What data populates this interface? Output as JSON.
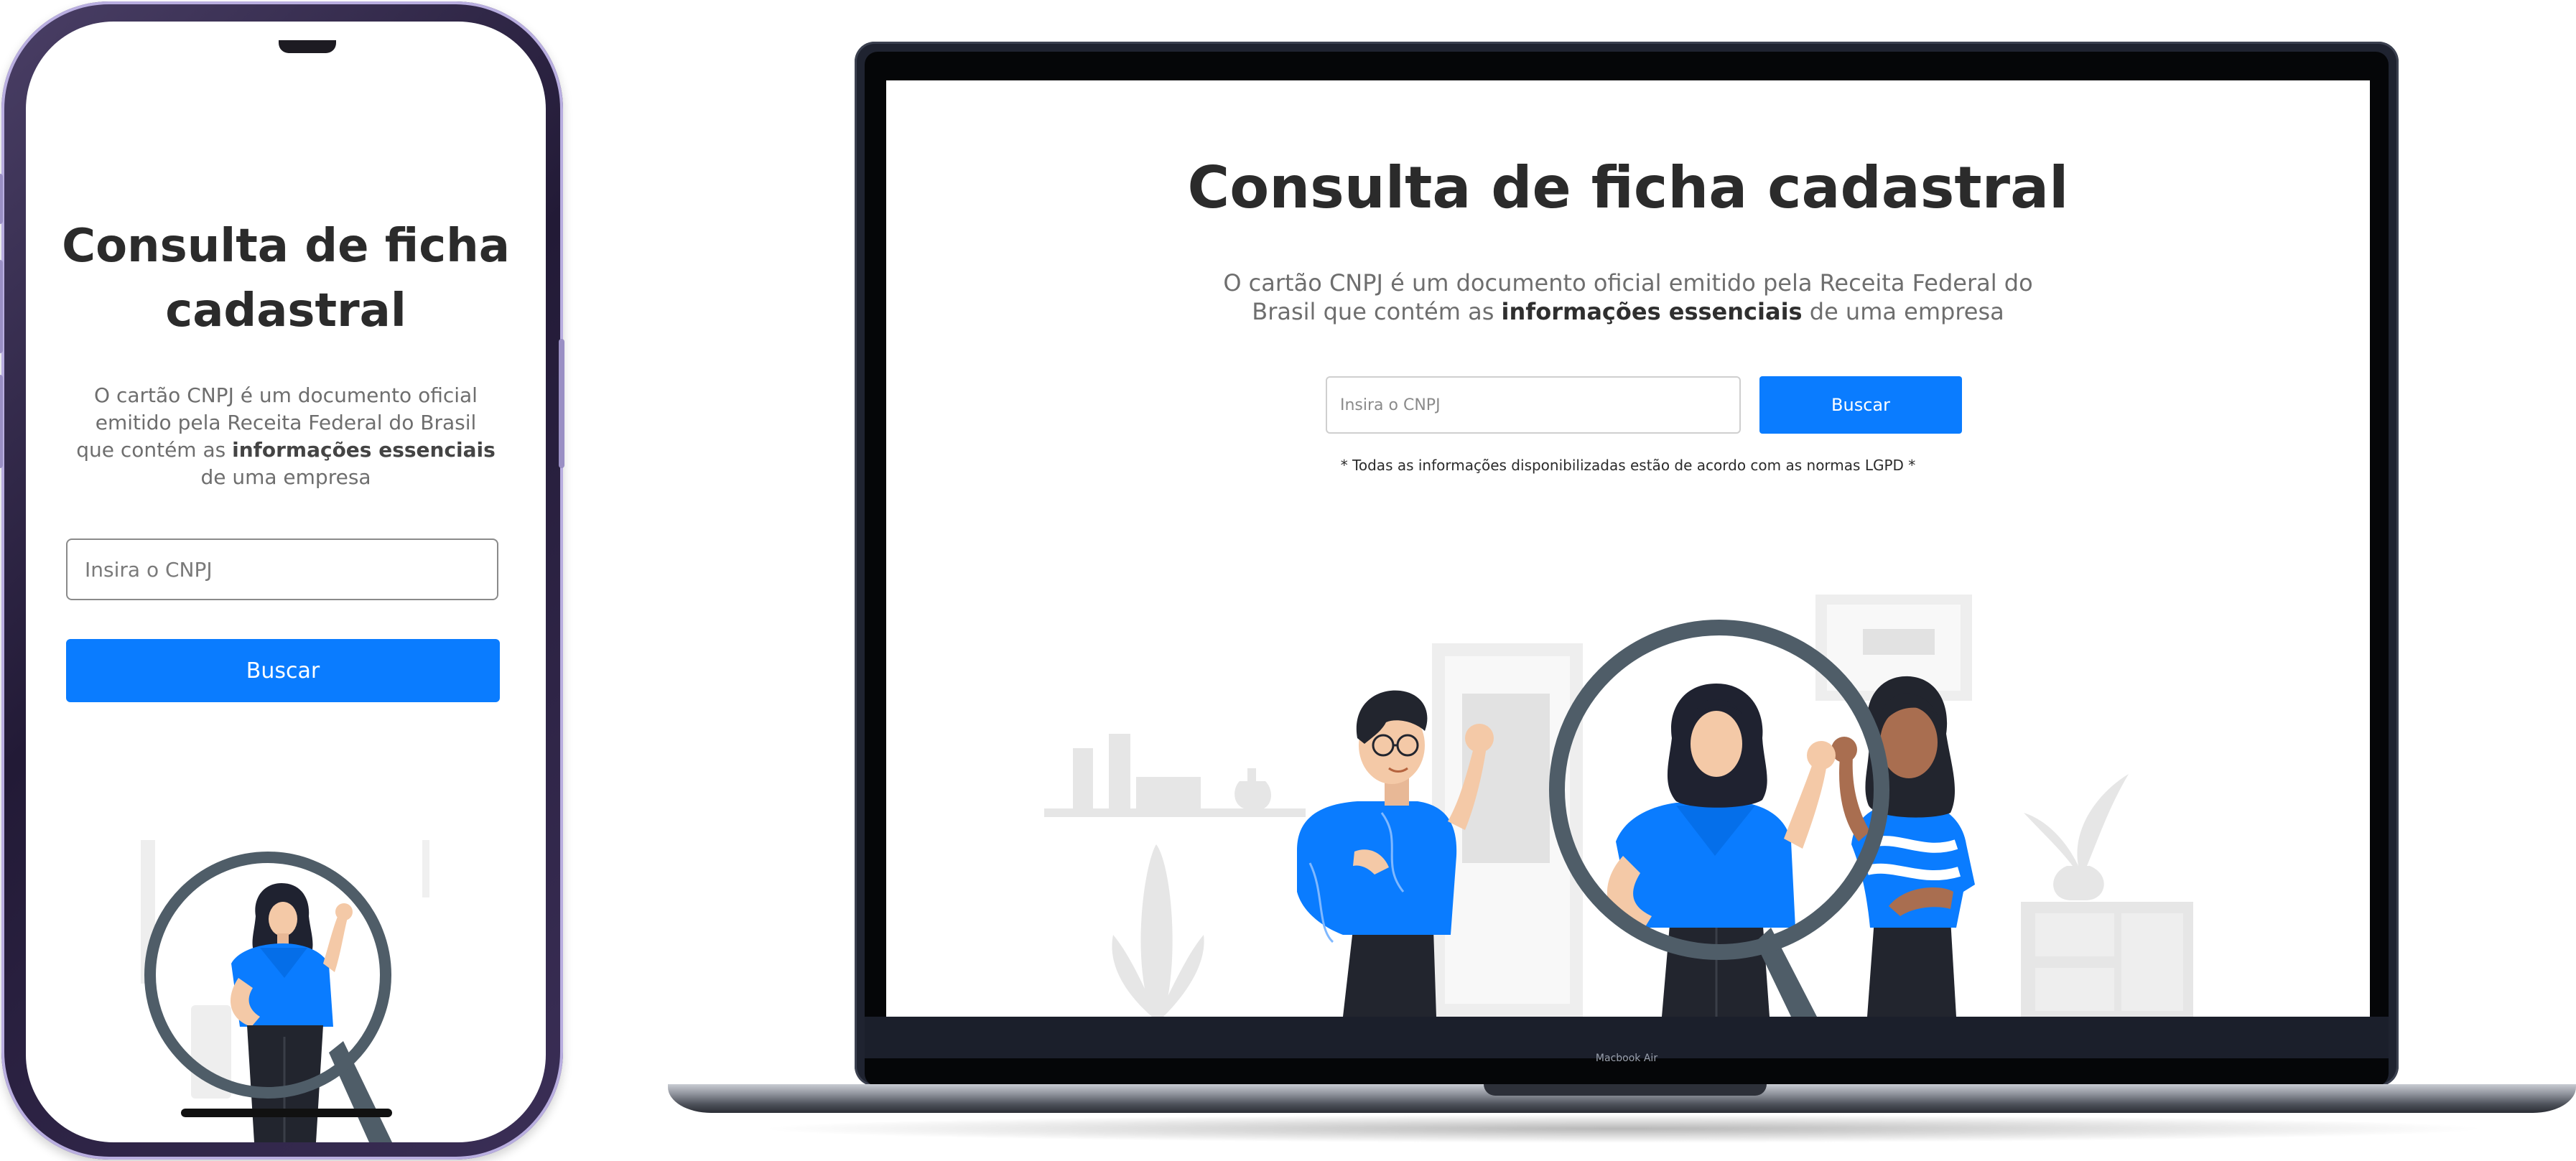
{
  "colors": {
    "accent": "#0a7cff",
    "title_text": "#2b2b2b",
    "body_text": "#6e6e6e",
    "illustration_gray": "#e6e6e6",
    "magnifier_ring": "#4f5d68"
  },
  "mobile": {
    "title": "Consulta de ficha cadastral",
    "description_prefix": "O cartão CNPJ é um documento oficial emitido pela Receita Federal do Brasil que contém as ",
    "description_bold": "informações essenciais",
    "description_suffix": " de uma empresa",
    "search": {
      "placeholder": "Insira o CNPJ",
      "value": ""
    },
    "button_label": "Buscar",
    "illustration_icon": "magnifier-person-illustration"
  },
  "desktop": {
    "title": "Consulta de ficha cadastral",
    "description_prefix": "O cartão CNPJ é um documento oficial emitido pela Receita Federal do Brasil que contém as ",
    "description_bold": "informações essenciais",
    "description_suffix": " de uma empresa",
    "search": {
      "placeholder": "Insira o CNPJ",
      "value": ""
    },
    "button_label": "Buscar",
    "note": "* Todas as informações disponibilizadas estão de acordo com as normas LGPD *",
    "illustration_icon": "people-magnifier-illustration"
  },
  "device": {
    "laptop_label": "Macbook Air"
  }
}
